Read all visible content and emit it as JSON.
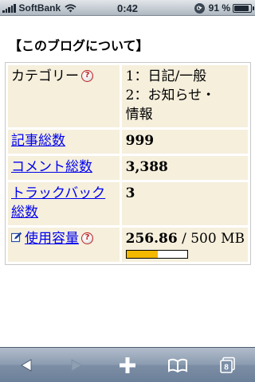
{
  "status_bar": {
    "carrier": "SoftBank",
    "time": "0:42",
    "battery_percent": "91 %",
    "battery_level": 0.91
  },
  "page": {
    "section_title": "【このブログについて】",
    "categories": {
      "label": "カテゴリー",
      "items": [
        "1：日記/一般",
        "2：お知らせ・",
        "情報"
      ]
    },
    "posts": {
      "label": "記事総数",
      "value": "999"
    },
    "comments": {
      "label": "コメント総数",
      "value": "3,388"
    },
    "trackbacks": {
      "label": "トラックバック総数",
      "value": "3"
    },
    "storage": {
      "label": "使用容量",
      "used": "256.86",
      "separator": " / ",
      "total": "500 MB",
      "usage_fraction": 0.5137
    }
  },
  "toolbar": {
    "buttons": [
      "back-icon",
      "forward-icon",
      "add-icon",
      "bookmarks-icon",
      "pages-icon"
    ],
    "pages_count": "8"
  },
  "colors": {
    "link": "#0000ee",
    "cell_background": "#f5efdc",
    "usage_bar_fill": "#f3b800",
    "help_icon": "#c02020"
  }
}
